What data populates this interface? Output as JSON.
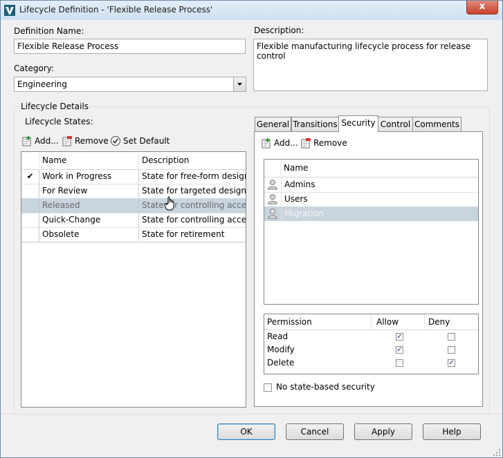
{
  "window": {
    "title": "Lifecycle Definition - 'Flexible Release Process'",
    "close_label": "x"
  },
  "definition_name": {
    "label": "Definition Name:",
    "value": "Flexible Release Process"
  },
  "description": {
    "label": "Description:",
    "value": "Flexible manufacturing lifecycle process for release control"
  },
  "category": {
    "label": "Category:",
    "value": "Engineering"
  },
  "lifecycle_details": {
    "label": "Lifecycle Details",
    "states_label": "Lifecycle States:",
    "toolbar": {
      "add": "Add...",
      "remove": "Remove",
      "set_default": "Set Default"
    },
    "columns": [
      "Name",
      "Description"
    ],
    "rows": [
      {
        "default": true,
        "name": "Work in Progress",
        "description": "State for free-form design ..."
      },
      {
        "default": false,
        "name": "For Review",
        "description": "State for targeted design r..."
      },
      {
        "default": false,
        "name": "Released",
        "description": "State for controlling acces..."
      },
      {
        "default": false,
        "name": "Quick-Change",
        "description": "State for controlling acces..."
      },
      {
        "default": false,
        "name": "Obsolete",
        "description": "State for retirement"
      }
    ]
  },
  "tabs": [
    "General",
    "Transitions",
    "Security",
    "Control",
    "Comments"
  ],
  "security": {
    "toolbar": {
      "add": "Add...",
      "remove": "Remove"
    },
    "name_column": "Name",
    "members": [
      "Admins",
      "Users",
      "Migration"
    ],
    "permission_columns": [
      "Permission",
      "Allow",
      "Deny"
    ],
    "permissions": [
      {
        "name": "Read",
        "allow": true,
        "deny": false
      },
      {
        "name": "Modify",
        "allow": true,
        "deny": false
      },
      {
        "name": "Delete",
        "allow": false,
        "deny": true
      }
    ],
    "no_state_security": "No state-based security"
  },
  "buttons": {
    "ok": "OK",
    "cancel": "Cancel",
    "apply": "Apply",
    "help": "Help"
  },
  "colors": {
    "selected_row": "#c8d4de",
    "title_bar": "#cfdff0",
    "close_button": "#c9422d"
  }
}
